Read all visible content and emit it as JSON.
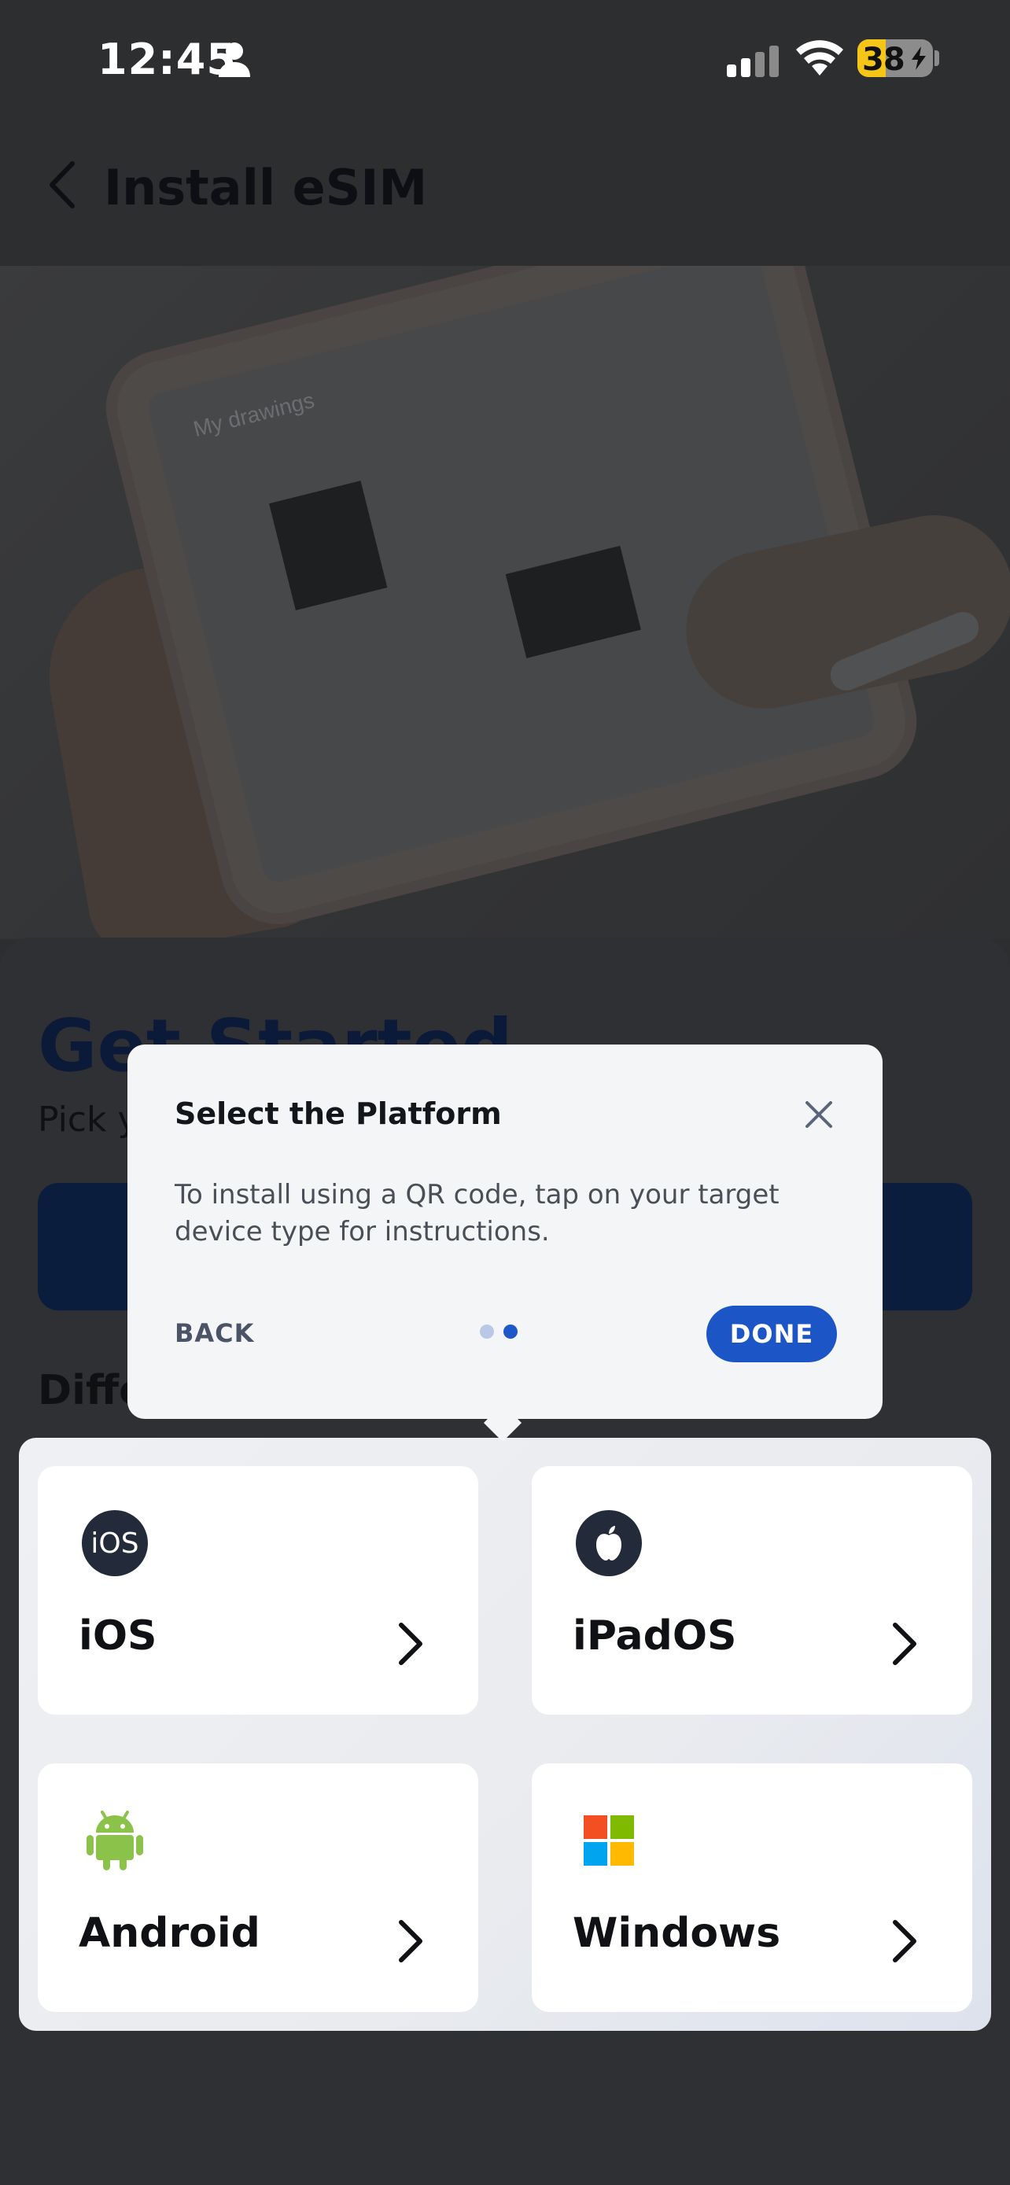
{
  "status_bar": {
    "time": "12:45",
    "battery_level": "38",
    "battery_fraction": 0.38,
    "icons": [
      "person-icon",
      "signal-icon",
      "wifi-icon",
      "battery-charging-icon"
    ]
  },
  "header": {
    "title": "Install eSIM",
    "back_icon": "chevron-left-icon"
  },
  "hero": {
    "caption": "My drawings"
  },
  "main": {
    "heading": "Get Started",
    "subtitle_fragment": "Pick y",
    "section_fragment": "Diffe"
  },
  "dialog": {
    "title": "Select the Platform",
    "body": "To install using a QR code, tap on your target device type for instructions.",
    "back_label": "BACK",
    "done_label": "DONE",
    "page_index": 2,
    "page_count": 2,
    "close_icon": "close-icon"
  },
  "platforms": [
    {
      "label": "iOS",
      "icon": "ios-icon",
      "icon_text": "iOS"
    },
    {
      "label": "iPadOS",
      "icon": "apple-icon"
    },
    {
      "label": "Android",
      "icon": "android-icon"
    },
    {
      "label": "Windows",
      "icon": "windows-icon"
    }
  ],
  "colors": {
    "accent": "#1c55c6",
    "dialog_bg": "#f4f5f7",
    "overlay_bg": "#2d2e30",
    "android_green": "#8bc34a",
    "windows_red": "#f25022",
    "windows_green": "#7fba00",
    "windows_blue": "#00a4ef",
    "windows_yellow": "#ffb900"
  }
}
